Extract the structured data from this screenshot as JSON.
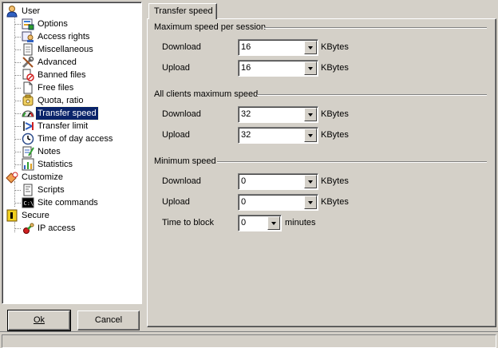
{
  "tree": {
    "items": [
      {
        "label": "User",
        "icon": "user-icon",
        "level": 0
      },
      {
        "label": "Options",
        "icon": "options-icon",
        "level": 1
      },
      {
        "label": "Access rights",
        "icon": "access-rights-icon",
        "level": 1
      },
      {
        "label": "Miscellaneous",
        "icon": "document-icon",
        "level": 1
      },
      {
        "label": "Advanced",
        "icon": "tools-icon",
        "level": 1
      },
      {
        "label": "Banned files",
        "icon": "banned-file-icon",
        "level": 1
      },
      {
        "label": "Free files",
        "icon": "file-icon",
        "level": 1
      },
      {
        "label": "Quota, ratio",
        "icon": "quota-icon",
        "level": 1
      },
      {
        "label": "Transfer speed",
        "icon": "speedometer-icon",
        "level": 1,
        "selected": true
      },
      {
        "label": "Transfer limit",
        "icon": "transfer-limit-icon",
        "level": 1
      },
      {
        "label": "Time of day access",
        "icon": "clock-icon",
        "level": 1
      },
      {
        "label": "Notes",
        "icon": "notes-icon",
        "level": 1
      },
      {
        "label": "Statistics",
        "icon": "statistics-icon",
        "level": 1
      },
      {
        "label": "Customize",
        "icon": "customize-icon",
        "level": 0
      },
      {
        "label": "Scripts",
        "icon": "script-icon",
        "level": 1
      },
      {
        "label": "Site commands",
        "icon": "console-icon",
        "level": 1
      },
      {
        "label": "Secure",
        "icon": "secure-icon",
        "level": 0
      },
      {
        "label": "IP access",
        "icon": "ip-access-icon",
        "level": 1
      }
    ]
  },
  "buttons": {
    "ok": "Ok",
    "cancel": "Cancel"
  },
  "tab": {
    "label": "Transfer speed"
  },
  "groups": {
    "session": {
      "title": "Maximum speed per session",
      "download_label": "Download",
      "download_value": "16",
      "upload_label": "Upload",
      "upload_value": "16",
      "unit": "KBytes"
    },
    "all_clients": {
      "title": "All clients maximum speed",
      "download_label": "Download",
      "download_value": "32",
      "upload_label": "Upload",
      "upload_value": "32",
      "unit": "KBytes"
    },
    "minimum": {
      "title": "Minimum speed",
      "download_label": "Download",
      "download_value": "0",
      "upload_label": "Upload",
      "upload_value": "0",
      "unit": "KBytes",
      "block_label": "Time to block",
      "block_value": "0",
      "block_unit": "minutes"
    }
  },
  "colors": {
    "selection": "#0a246a",
    "face": "#d4d0c8"
  }
}
